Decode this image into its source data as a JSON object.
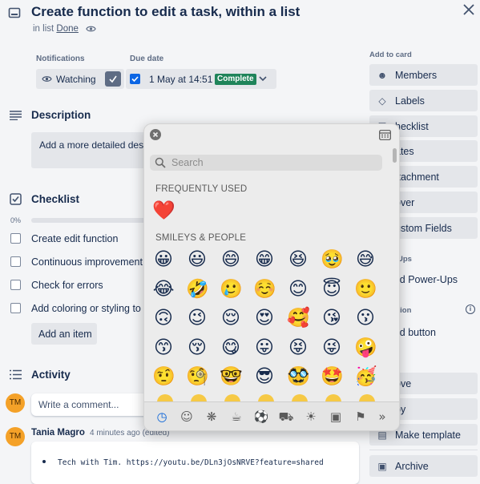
{
  "header": {
    "title": "Create function to edit a task, within a list",
    "list_prefix": "in list",
    "list_name": "Done",
    "close_icon": "close-icon",
    "card_icon": "card-icon",
    "watch_icon": "eye-icon"
  },
  "notifications": {
    "label": "Notifications",
    "watch_label": "Watching"
  },
  "due_date": {
    "label": "Due date",
    "value": "1 May at 14:51",
    "badge": "Complete",
    "badge_color": "#1f845a"
  },
  "description": {
    "heading": "Description",
    "placeholder": "Add a more detailed desc"
  },
  "checklist": {
    "heading": "Checklist",
    "progress_text": "0%",
    "progress": 0,
    "items": [
      "Create edit function",
      "Continuous improvement",
      "Check for errors",
      "Add coloring or styling to th"
    ],
    "add_item_label": "Add an item"
  },
  "activity": {
    "heading": "Activity",
    "avatar_initials": "TM",
    "comment_placeholder": "Write a comment...",
    "author": "Tania Magro",
    "time": "4 minutes ago (edited)",
    "comment_text": "Tech with Tim. https://youtu.be/DLn3jOsNRVE?feature=shared"
  },
  "sidebar": {
    "add_to_card": "Add to card",
    "buttons": [
      {
        "label": "Members",
        "icon": "person-icon"
      },
      {
        "label": "Labels",
        "icon": "tag-icon"
      },
      {
        "label": "hecklist",
        "icon": "checklist-icon"
      },
      {
        "label": "ates",
        "icon": "clock-icon"
      },
      {
        "label": "ttachment",
        "icon": "paperclip-icon"
      },
      {
        "label": "over",
        "icon": "cover-icon"
      },
      {
        "label": "ustom Fields",
        "icon": "fields-icon"
      }
    ],
    "powerups_heading": "Ups",
    "add_powerups": "ld Power-Ups",
    "automation_heading": "tion",
    "add_button": "ld button",
    "actions": [
      {
        "label": "ove",
        "icon": "move-icon"
      },
      {
        "label": "py",
        "icon": "copy-icon"
      },
      {
        "label": "Make template",
        "icon": "template-icon"
      },
      {
        "label": "Archive",
        "icon": "archive-icon"
      }
    ]
  },
  "emoji_picker": {
    "search_placeholder": "Search",
    "frequently_used_heading": "FREQUENTLY USED",
    "frequently_used": [
      "❤️"
    ],
    "smileys_heading": "SMILEYS & PEOPLE",
    "smileys_rows": [
      [
        "😀",
        "😃",
        "😄",
        "😁",
        "😆",
        "🥹",
        "😅"
      ],
      [
        "😂",
        "🤣",
        "🥲",
        "☺️",
        "😊",
        "😇",
        "🙂"
      ],
      [
        "🙃",
        "😉",
        "😌",
        "😍",
        "🥰",
        "😘",
        "😗"
      ],
      [
        "😙",
        "😚",
        "😋",
        "😛",
        "😝",
        "😜",
        "🤪"
      ],
      [
        "🤨",
        "🧐",
        "🤓",
        "😎",
        "🥸",
        "🤩",
        "🥳"
      ]
    ],
    "category_icons": [
      "clock-icon",
      "smiley-icon",
      "bear-icon",
      "food-icon",
      "ball-icon",
      "car-icon",
      "bulb-icon",
      "symbols-icon",
      "flag-icon",
      "more-icon"
    ]
  }
}
